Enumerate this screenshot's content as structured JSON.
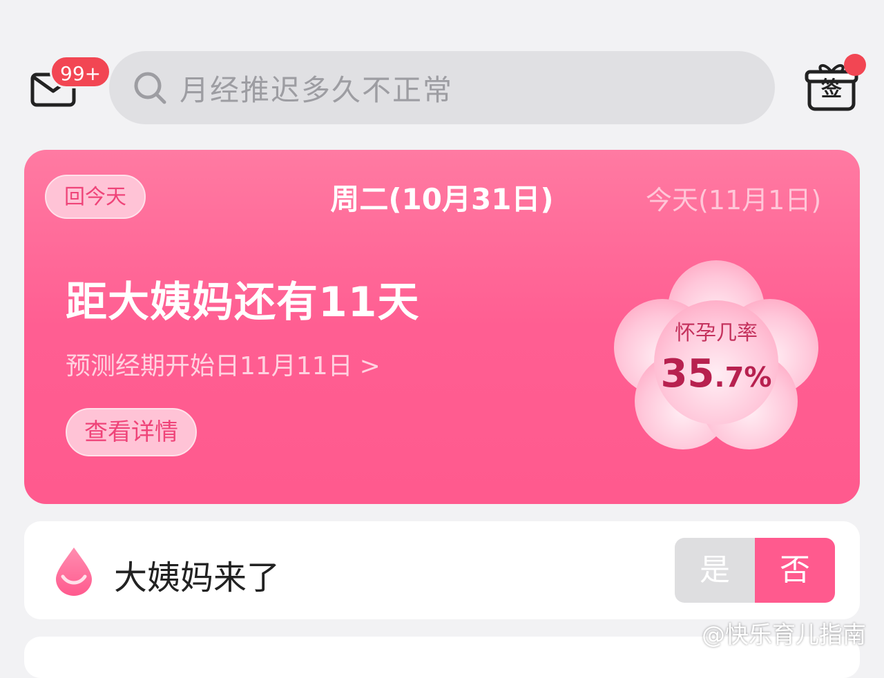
{
  "header": {
    "badge": "99+",
    "search_placeholder": "月经推迟多久不正常",
    "signin_label": "签"
  },
  "card": {
    "today_button": "回今天",
    "current_date": "周二(10月31日)",
    "next_date": "今天(11月1日)",
    "countdown": "距大姨妈还有11天",
    "prediction": "预测经期开始日11月11日",
    "prediction_chevron": ">",
    "details_button": "查看详情",
    "pregnancy_label": "怀孕几率",
    "pregnancy_int": "35",
    "pregnancy_dec": ".7%"
  },
  "period_row": {
    "label": "大姨妈来了",
    "yes": "是",
    "no": "否",
    "selected": "否"
  },
  "watermark": "@快乐育儿指南",
  "colors": {
    "accent": "#ff5a8e",
    "badge": "#f24653",
    "background": "#f2f2f4"
  }
}
